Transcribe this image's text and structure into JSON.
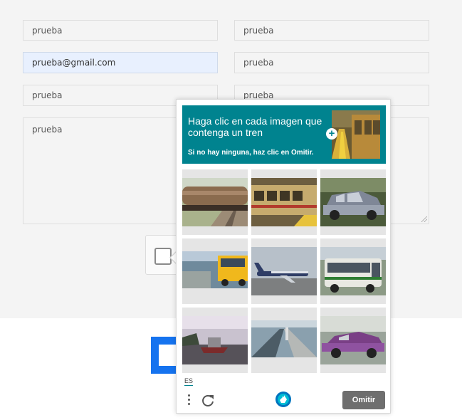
{
  "form": {
    "fields": [
      {
        "value": "prueba"
      },
      {
        "value": "prueba"
      },
      {
        "value": "prueba@gmail.com"
      },
      {
        "value": "prueba"
      },
      {
        "value": "prueba"
      },
      {
        "value": "prueba"
      }
    ],
    "message": "prueba"
  },
  "challenge": {
    "prompt": "Haga clic en cada imagen que contenga un tren",
    "hint": "Si no hay ninguna, haz clic en Omitir.",
    "language": "ES",
    "skip_label": "Omitir",
    "colors": {
      "prompt_bg": "#00838f",
      "skip_bg": "#6e6e6e",
      "logo_blue": "#1573ef"
    },
    "images": [
      {
        "icon": "tanker-train-image"
      },
      {
        "icon": "subway-train-image"
      },
      {
        "icon": "old-car-image"
      },
      {
        "icon": "yellow-bus-image"
      },
      {
        "icon": "airplane-image"
      },
      {
        "icon": "city-bus-image"
      },
      {
        "icon": "boat-image"
      },
      {
        "icon": "station-platform-image"
      },
      {
        "icon": "purple-car-image"
      }
    ]
  }
}
